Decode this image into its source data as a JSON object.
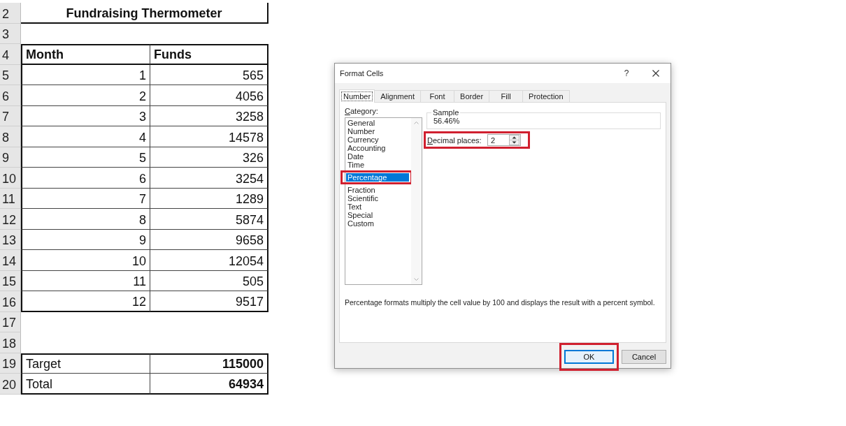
{
  "sheet": {
    "rows": [
      {
        "number": "2",
        "kind": "title",
        "cells": [
          "Fundraising Thermometer"
        ]
      },
      {
        "number": "3",
        "kind": "blank"
      },
      {
        "number": "4",
        "kind": "header",
        "cells": [
          "Month",
          "Funds"
        ]
      },
      {
        "number": "5",
        "kind": "data",
        "cells": [
          "1",
          "565"
        ]
      },
      {
        "number": "6",
        "kind": "data",
        "cells": [
          "2",
          "4056"
        ]
      },
      {
        "number": "7",
        "kind": "data",
        "cells": [
          "3",
          "3258"
        ]
      },
      {
        "number": "8",
        "kind": "data",
        "cells": [
          "4",
          "14578"
        ]
      },
      {
        "number": "9",
        "kind": "data",
        "cells": [
          "5",
          "326"
        ]
      },
      {
        "number": "10",
        "kind": "data",
        "cells": [
          "6",
          "3254"
        ]
      },
      {
        "number": "11",
        "kind": "data",
        "cells": [
          "7",
          "1289"
        ]
      },
      {
        "number": "12",
        "kind": "data",
        "cells": [
          "8",
          "5874"
        ]
      },
      {
        "number": "13",
        "kind": "data",
        "cells": [
          "9",
          "9658"
        ]
      },
      {
        "number": "14",
        "kind": "data",
        "cells": [
          "10",
          "12054"
        ]
      },
      {
        "number": "15",
        "kind": "data",
        "cells": [
          "11",
          "505"
        ]
      },
      {
        "number": "16",
        "kind": "data",
        "cells": [
          "12",
          "9517"
        ]
      },
      {
        "number": "17",
        "kind": "blank"
      },
      {
        "number": "18",
        "kind": "blank"
      },
      {
        "number": "19",
        "kind": "summary",
        "cells": [
          "Target",
          "115000"
        ]
      },
      {
        "number": "20",
        "kind": "summary",
        "cells": [
          "Total",
          "64934"
        ]
      }
    ]
  },
  "dialog": {
    "title": "Format Cells",
    "help_button": "?",
    "tabs": [
      {
        "label": "Number",
        "selected": true
      },
      {
        "label": "Alignment",
        "selected": false
      },
      {
        "label": "Font",
        "selected": false
      },
      {
        "label": "Border",
        "selected": false
      },
      {
        "label": "Fill",
        "selected": false
      },
      {
        "label": "Protection",
        "selected": false
      }
    ],
    "category": {
      "label": "Category:",
      "items": [
        {
          "label": "General",
          "selected": false,
          "highlighted": false
        },
        {
          "label": "Number",
          "selected": false,
          "highlighted": false
        },
        {
          "label": "Currency",
          "selected": false,
          "highlighted": false
        },
        {
          "label": "Accounting",
          "selected": false,
          "highlighted": false
        },
        {
          "label": "Date",
          "selected": false,
          "highlighted": false
        },
        {
          "label": "Time",
          "selected": false,
          "highlighted": false
        },
        {
          "label": "Percentage",
          "selected": true,
          "highlighted": true
        },
        {
          "label": "Fraction",
          "selected": false,
          "highlighted": false
        },
        {
          "label": "Scientific",
          "selected": false,
          "highlighted": false
        },
        {
          "label": "Text",
          "selected": false,
          "highlighted": false
        },
        {
          "label": "Special",
          "selected": false,
          "highlighted": false
        },
        {
          "label": "Custom",
          "selected": false,
          "highlighted": false
        }
      ]
    },
    "sample": {
      "label": "Sample",
      "value": "56.46%"
    },
    "decimal_places": {
      "label": "Decimal places:",
      "value": "2",
      "highlighted": true
    },
    "description": "Percentage formats multiply the cell value by 100 and displays the result with a percent symbol.",
    "buttons": [
      {
        "label": "OK",
        "default": true,
        "highlighted": true
      },
      {
        "label": "Cancel",
        "default": false,
        "highlighted": false
      }
    ]
  }
}
